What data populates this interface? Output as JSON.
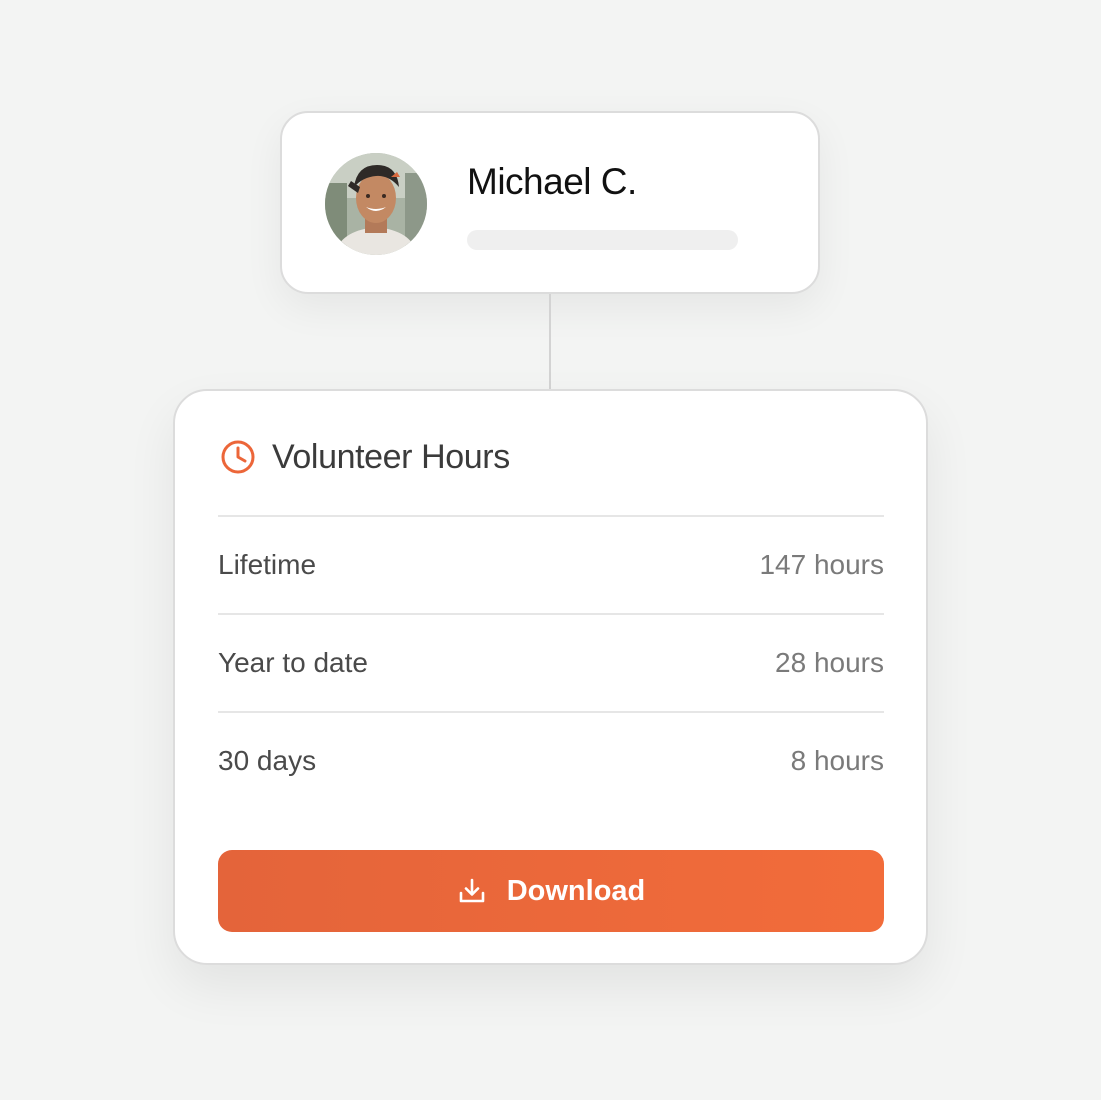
{
  "profile": {
    "name": "Michael C.",
    "avatar_icon": "avatar-photo"
  },
  "hours_card": {
    "title": "Volunteer Hours",
    "title_icon": "clock-icon",
    "stats": [
      {
        "label": "Lifetime",
        "value": "147 hours"
      },
      {
        "label": "Year to date",
        "value": "28 hours"
      },
      {
        "label": "30 days",
        "value": "8 hours"
      }
    ],
    "download_button": {
      "label": "Download",
      "icon": "download-icon"
    }
  },
  "colors": {
    "background": "#f3f4f3",
    "accent": "#ec6639",
    "card": "#ffffff",
    "divider": "#e6e6e6"
  }
}
